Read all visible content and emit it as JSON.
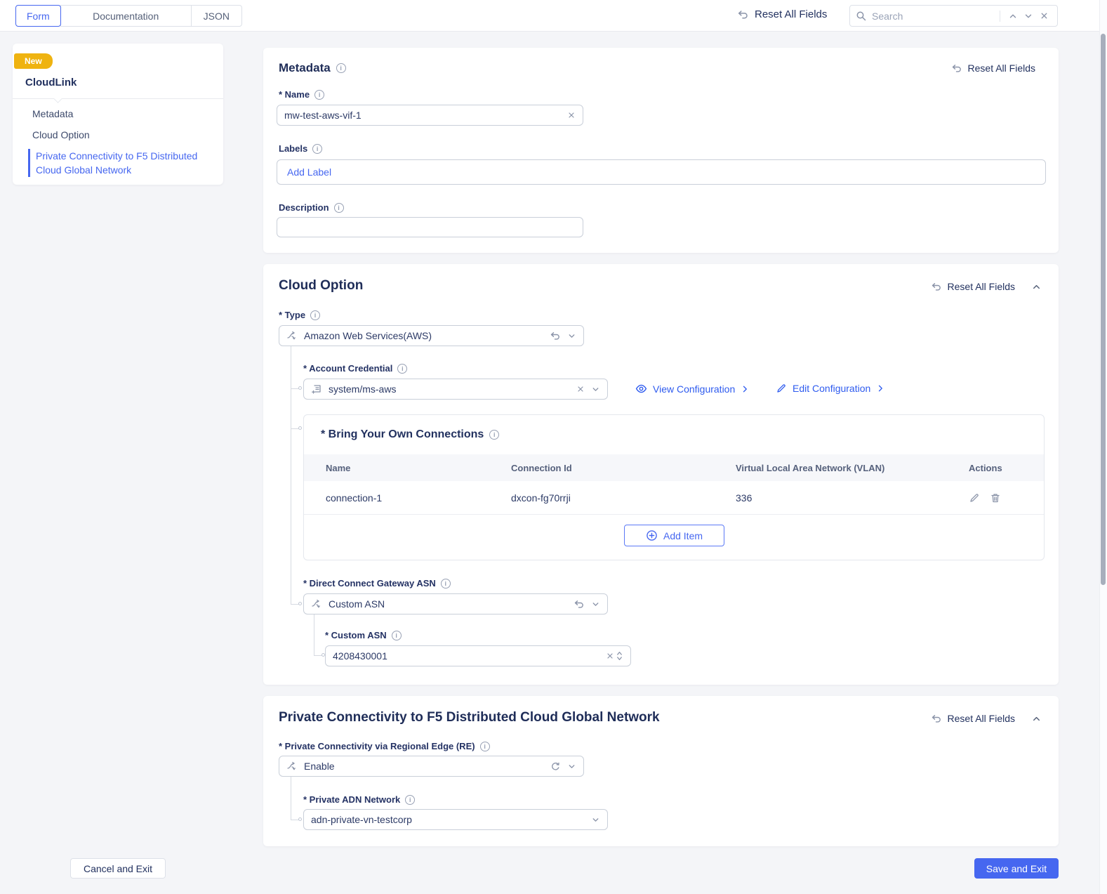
{
  "topbar": {
    "tabs": [
      {
        "label": "Form"
      },
      {
        "label": "Documentation"
      },
      {
        "label": "JSON"
      }
    ],
    "reset_all_label": "Reset All Fields",
    "search": {
      "placeholder": "Search"
    }
  },
  "sidebar": {
    "badge": "New",
    "title": "CloudLink",
    "items": [
      {
        "label": "Metadata"
      },
      {
        "label": "Cloud Option"
      },
      {
        "label": "Private Connectivity to F5 Distributed Cloud Global Network"
      }
    ]
  },
  "metadata": {
    "title": "Metadata",
    "reset_label": "Reset All Fields",
    "name_label": "* Name",
    "name_value": "mw-test-aws-vif-1",
    "labels_label": "Labels",
    "labels_placeholder": "Add Label",
    "description_label": "Description",
    "description_value": ""
  },
  "cloud_option": {
    "title": "Cloud Option",
    "reset_label": "Reset All Fields",
    "type_label": "* Type",
    "type_value": "Amazon Web Services(AWS)",
    "account_credential_label": "* Account Credential",
    "account_credential_value": "system/ms-aws",
    "view_configuration_label": "View Configuration",
    "edit_configuration_label": "Edit Configuration",
    "byoc": {
      "title": "* Bring Your Own Connections",
      "columns": [
        "Name",
        "Connection Id",
        "Virtual Local Area Network (VLAN)",
        "Actions"
      ],
      "rows": [
        {
          "name": "connection-1",
          "connection_id": "dxcon-fg70rrji",
          "vlan": "336"
        }
      ],
      "add_item_label": "Add Item"
    },
    "dcg_asn_label": "* Direct Connect Gateway ASN",
    "dcg_asn_value": "Custom ASN",
    "custom_asn_label": "* Custom ASN",
    "custom_asn_value": "4208430001"
  },
  "private_connectivity": {
    "title": "Private Connectivity to F5 Distributed Cloud Global Network",
    "reset_label": "Reset All Fields",
    "re_label": "* Private Connectivity via Regional Edge (RE)",
    "re_value": "Enable",
    "adn_label": "* Private ADN Network",
    "adn_value": "adn-private-vn-testcorp"
  },
  "footer": {
    "cancel_label": "Cancel and Exit",
    "save_label": "Save and Exit"
  },
  "colors": {
    "primary_blue": "#4667f0",
    "link_blue": "#2e5bef",
    "navy_text": "#22315f",
    "badge_yellow": "#efb310"
  }
}
